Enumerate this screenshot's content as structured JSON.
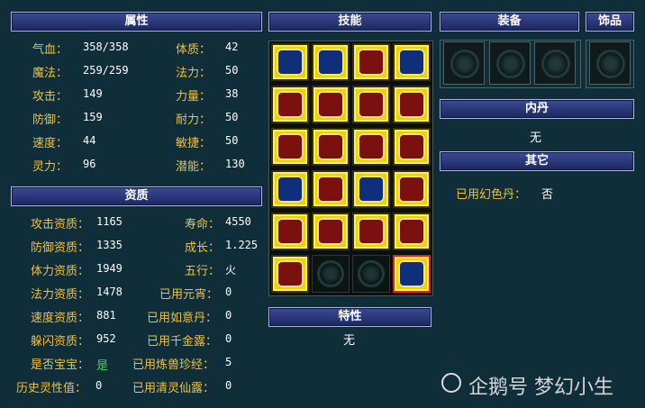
{
  "headers": {
    "attributes": "属性",
    "aptitude": "资质",
    "skills": "技能",
    "equipment": "装备",
    "accessory": "饰品",
    "inner_dan": "内丹",
    "other": "其它",
    "traits": "特性"
  },
  "attributes": [
    {
      "label": "气血：",
      "value": "358/358"
    },
    {
      "label": "魔法：",
      "value": "259/259"
    },
    {
      "label": "攻击：",
      "value": "149"
    },
    {
      "label": "防御：",
      "value": "159"
    },
    {
      "label": "速度：",
      "value": "44"
    },
    {
      "label": "灵力：",
      "value": "96"
    }
  ],
  "attributes_right": [
    {
      "label": "体质：",
      "value": "42"
    },
    {
      "label": "法力：",
      "value": "50"
    },
    {
      "label": "力量：",
      "value": "38"
    },
    {
      "label": "耐力：",
      "value": "50"
    },
    {
      "label": "敏捷：",
      "value": "50"
    },
    {
      "label": "潜能：",
      "value": "130"
    }
  ],
  "aptitude_left": [
    {
      "label": "攻击资质：",
      "value": "1165"
    },
    {
      "label": "防御资质：",
      "value": "1335"
    },
    {
      "label": "体力资质：",
      "value": "1949"
    },
    {
      "label": "法力资质：",
      "value": "1478"
    },
    {
      "label": "速度资质：",
      "value": "881"
    },
    {
      "label": "躲闪资质：",
      "value": "952"
    },
    {
      "label": "是否宝宝：",
      "value": "是"
    },
    {
      "label": "历史灵性值：",
      "value": "0"
    }
  ],
  "aptitude_right": [
    {
      "label": "寿命：",
      "value": "4550"
    },
    {
      "label": "成长：",
      "value": "1.225"
    },
    {
      "label": "五行：",
      "value": "火"
    },
    {
      "label": "已用元宵：",
      "value": "0"
    },
    {
      "label": "已用如意丹：",
      "value": "0"
    },
    {
      "label": "已用千金露：",
      "value": "0"
    },
    {
      "label": "已用炼兽珍经：",
      "value": "5"
    },
    {
      "label": "已用清灵仙露：",
      "value": "0"
    }
  ],
  "skills": [
    {
      "icon": "wings-skill-icon",
      "style": "blue"
    },
    {
      "icon": "blessing-skill-icon",
      "style": "blue"
    },
    {
      "icon": "skull-skill-icon",
      "style": "red"
    },
    {
      "icon": "question-skill-icon",
      "style": "blue"
    },
    {
      "icon": "signal-skill-icon",
      "style": "red"
    },
    {
      "icon": "hourglass-skill-icon",
      "style": "red"
    },
    {
      "icon": "grid-skill-icon",
      "style": "red"
    },
    {
      "icon": "return-skill-icon",
      "style": "red"
    },
    {
      "icon": "slash-skill-icon",
      "style": "red"
    },
    {
      "icon": "figure-skill-icon",
      "style": "red"
    },
    {
      "icon": "hourglass-frame-skill-icon",
      "style": "red"
    },
    {
      "icon": "serpent-skill-icon",
      "style": "red"
    },
    {
      "icon": "timer-skill-icon",
      "style": "blue"
    },
    {
      "icon": "sun-spirit-skill-icon",
      "style": "red"
    },
    {
      "icon": "shield-skill-icon",
      "style": "blue"
    },
    {
      "icon": "lightning-skill-icon",
      "style": "red"
    },
    {
      "icon": "guardian-skill-icon",
      "style": "red"
    },
    {
      "icon": "flame-skill-icon",
      "style": "red"
    },
    {
      "icon": "sword-skill-icon",
      "style": "red"
    },
    {
      "icon": "gear-sun-skill-icon",
      "style": "red"
    },
    {
      "icon": "sunburst-skill-icon",
      "style": "red"
    },
    {
      "icon": "empty-slot-icon",
      "style": "empty"
    },
    {
      "icon": "empty-slot-icon",
      "style": "empty"
    },
    {
      "icon": "wave-skill-icon",
      "style": "blue-selected"
    }
  ],
  "inner_dan_value": "无",
  "traits_value": "无",
  "other": {
    "label": "已用幻色丹：",
    "value": "否"
  },
  "watermark": "企鹅号 梦幻小生",
  "colors": {
    "label": "#f0c040",
    "header": "#2a3680",
    "background": "#0f2e3a",
    "yes": "#31e04a"
  }
}
